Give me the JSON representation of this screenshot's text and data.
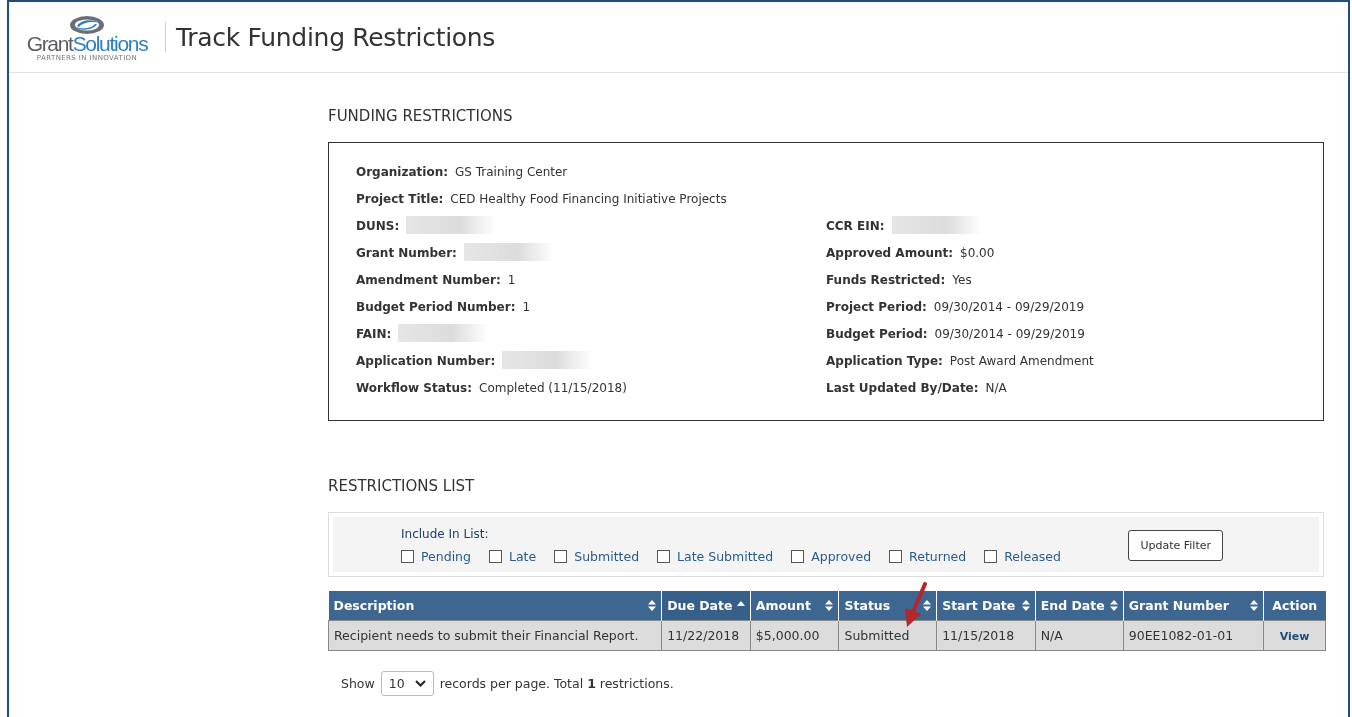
{
  "header": {
    "logo": {
      "first": "Grant",
      "second": "Solutions",
      "tagline": "PARTNERS IN INNOVATION"
    },
    "title": "Track Funding Restrictions"
  },
  "summary": {
    "heading": "FUNDING RESTRICTIONS",
    "full_rows": [
      {
        "label": "Organization:",
        "value": "GS Training Center"
      },
      {
        "label": "Project Title:",
        "value": "CED Healthy Food Financing Initiative Projects"
      }
    ],
    "left": [
      {
        "label": "DUNS:",
        "redacted": true
      },
      {
        "label": "Grant Number:",
        "redacted": true
      },
      {
        "label": "Amendment Number:",
        "value": "1"
      },
      {
        "label": "Budget Period Number:",
        "value": "1"
      },
      {
        "label": "FAIN:",
        "redacted": true
      },
      {
        "label": "Application Number:",
        "redacted": true
      },
      {
        "label": "Workflow Status:",
        "value": "Completed (11/15/2018)"
      }
    ],
    "right": [
      {
        "label": "CCR EIN:",
        "redacted": true
      },
      {
        "label": "Approved Amount:",
        "value": "$0.00"
      },
      {
        "label": "Funds Restricted:",
        "value": "Yes"
      },
      {
        "label": "Project Period:",
        "value": "09/30/2014 - 09/29/2019"
      },
      {
        "label": "Budget Period:",
        "value": "09/30/2014 - 09/29/2019"
      },
      {
        "label": "Application Type:",
        "value": "Post Award Amendment"
      },
      {
        "label": "Last Updated By/Date:",
        "value": "N/A"
      }
    ]
  },
  "restrictions": {
    "heading": "RESTRICTIONS LIST",
    "filter": {
      "label": "Include In List:",
      "options": [
        {
          "label": "Pending",
          "checked": false
        },
        {
          "label": "Late",
          "checked": false
        },
        {
          "label": "Submitted",
          "checked": false
        },
        {
          "label": "Late Submitted",
          "checked": false
        },
        {
          "label": "Approved",
          "checked": false
        },
        {
          "label": "Returned",
          "checked": false
        },
        {
          "label": "Released",
          "checked": false
        }
      ],
      "button": "Update Filter"
    },
    "table": {
      "columns": [
        {
          "label": "Description",
          "sortable": true,
          "sorted": false
        },
        {
          "label": "Due Date",
          "sortable": true,
          "sorted": true
        },
        {
          "label": "Amount",
          "sortable": true,
          "sorted": false
        },
        {
          "label": "Status",
          "sortable": true,
          "sorted": false
        },
        {
          "label": "Start Date",
          "sortable": true,
          "sorted": false
        },
        {
          "label": "End Date",
          "sortable": true,
          "sorted": false
        },
        {
          "label": "Grant Number",
          "sortable": true,
          "sorted": false
        },
        {
          "label": "Action",
          "sortable": false
        }
      ],
      "rows": [
        {
          "cells": [
            "Recipient needs to submit their Financial Report.",
            "11/22/2018",
            "$5,000.00",
            "Submitted",
            "11/15/2018",
            "N/A",
            "90EE1082-01-01"
          ],
          "action": "View"
        }
      ]
    },
    "pager": {
      "show": "Show",
      "page_size": "10",
      "text_before": "records per page. Total",
      "total": "1",
      "text_after": "restrictions."
    }
  },
  "annotation": {
    "kind": "arrow"
  }
}
